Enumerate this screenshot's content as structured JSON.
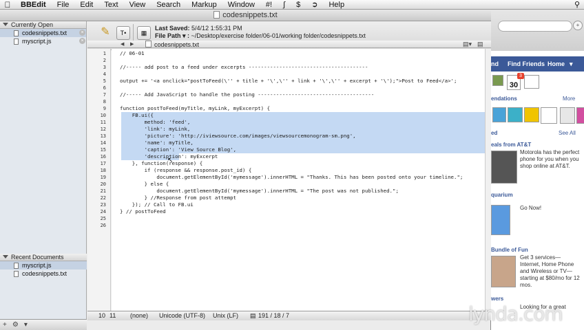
{
  "menubar": {
    "app": "BBEdit",
    "items": [
      "File",
      "Edit",
      "Text",
      "View",
      "Search",
      "Markup",
      "Window",
      "#!",
      "Help"
    ]
  },
  "window": {
    "title": "codesnippets.txt",
    "last_saved_label": "Last Saved:",
    "last_saved_value": "5/4/12 1:55:31 PM",
    "file_path_label": "File Path ▾ :",
    "file_path_value": "~/Desktop/exercise folder/06-01/working folder/codesnippets.txt"
  },
  "sidebar": {
    "open_header": "Currently Open Documents",
    "open_docs": [
      "codesnippets.txt",
      "myscript.js"
    ],
    "recent_header": "Recent Documents",
    "recent_docs": [
      "myscript.js",
      "codesnippets.txt"
    ],
    "bottom": {
      "add": "+",
      "gear": "⚙",
      "menu": "▾"
    }
  },
  "navbar": {
    "file": "codesnippets.txt",
    "back": "◀",
    "forward": "▶"
  },
  "editor": {
    "lines": [
      "// 06-01",
      "",
      "//----- add post to a feed under excerpts ---------------------------------------",
      "",
      "output += '<a onclick=\"postToFeed(\\'' + title + '\\',\\'' + link + '\\',\\'' + excerpt + '\\');\">Post to Feed</a>';",
      "",
      "//----- Add JavaScript to handle the posting --------------------------------------",
      "",
      "function postToFeed(myTitle, myLink, myExcerpt) {",
      "    FB.ui({",
      "        method: 'feed',",
      "        'link': myLink,",
      "        'picture': 'http://iviewsource.com/images/viewsourcemonogram-sm.png',",
      "        'name': myTitle,",
      "        'caption': 'View Source Blog',",
      "        'description': myExcerpt",
      "    }, function(response) {",
      "        if (response && response.post_id) {",
      "            document.getElementById('mymessage').innerHTML = \"Thanks. This has been posted onto your timeline.\";",
      "        } else {",
      "            document.getElementById('mymessage').innerHTML = \"The post was not published.\";",
      "        } //Response from post attempt",
      "    }); // Call to FB.ui",
      "} // postToFeed",
      "",
      ""
    ],
    "line_numbers": [
      "1",
      "2",
      "3",
      "4",
      "5",
      "6",
      "7",
      "8",
      "9",
      "10",
      "11",
      "12",
      "13",
      "14",
      "15",
      "16",
      "17",
      "18",
      "19",
      "20",
      "21",
      "22",
      "23",
      "24",
      "25",
      "26"
    ]
  },
  "status": {
    "line": "10",
    "col": "11",
    "language": "(none)",
    "encoding": "Unicode (UTF-8)",
    "line_endings": "Unix (LF)",
    "stats": "191 / 18 / 7"
  },
  "browser": {
    "nav_items": [
      "nd",
      "Find Friends",
      "Home"
    ],
    "calendar_day": "30",
    "badge": "3",
    "section1": "endations",
    "more": "More",
    "section2": "ed",
    "see_all": "See All",
    "ad1_title": "eals from AT&T",
    "ad1_text": "Motorola has the perfect phone for you when you shop online at AT&T.",
    "ad2_title": "quarium",
    "ad2_text": "Go Now!",
    "ad3_title": "Bundle of Fun",
    "ad3_text": "Get 3 services— Internet, Home Phone and Wireless or TV— starting at $80/mo for 12 mos.",
    "section3": "wers",
    "footer_text": "Looking for a great"
  },
  "watermark": "lynda.com"
}
